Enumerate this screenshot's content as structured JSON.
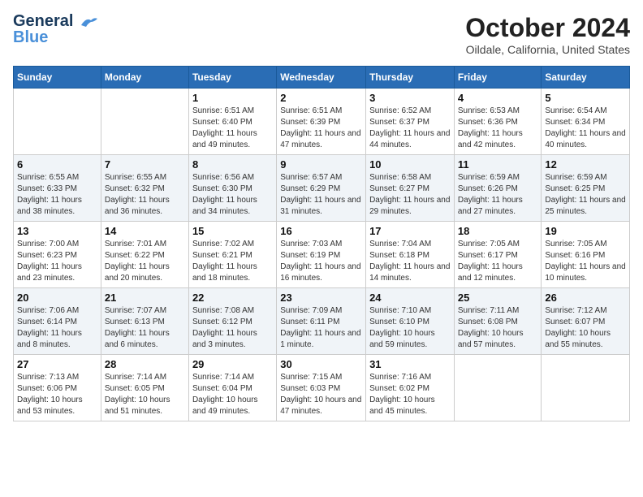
{
  "logo": {
    "line1": "General",
    "line2": "Blue"
  },
  "title": "October 2024",
  "location": "Oildale, California, United States",
  "days_header": [
    "Sunday",
    "Monday",
    "Tuesday",
    "Wednesday",
    "Thursday",
    "Friday",
    "Saturday"
  ],
  "weeks": [
    [
      {
        "day": "",
        "info": ""
      },
      {
        "day": "",
        "info": ""
      },
      {
        "day": "1",
        "info": "Sunrise: 6:51 AM\nSunset: 6:40 PM\nDaylight: 11 hours and 49 minutes."
      },
      {
        "day": "2",
        "info": "Sunrise: 6:51 AM\nSunset: 6:39 PM\nDaylight: 11 hours and 47 minutes."
      },
      {
        "day": "3",
        "info": "Sunrise: 6:52 AM\nSunset: 6:37 PM\nDaylight: 11 hours and 44 minutes."
      },
      {
        "day": "4",
        "info": "Sunrise: 6:53 AM\nSunset: 6:36 PM\nDaylight: 11 hours and 42 minutes."
      },
      {
        "day": "5",
        "info": "Sunrise: 6:54 AM\nSunset: 6:34 PM\nDaylight: 11 hours and 40 minutes."
      }
    ],
    [
      {
        "day": "6",
        "info": "Sunrise: 6:55 AM\nSunset: 6:33 PM\nDaylight: 11 hours and 38 minutes."
      },
      {
        "day": "7",
        "info": "Sunrise: 6:55 AM\nSunset: 6:32 PM\nDaylight: 11 hours and 36 minutes."
      },
      {
        "day": "8",
        "info": "Sunrise: 6:56 AM\nSunset: 6:30 PM\nDaylight: 11 hours and 34 minutes."
      },
      {
        "day": "9",
        "info": "Sunrise: 6:57 AM\nSunset: 6:29 PM\nDaylight: 11 hours and 31 minutes."
      },
      {
        "day": "10",
        "info": "Sunrise: 6:58 AM\nSunset: 6:27 PM\nDaylight: 11 hours and 29 minutes."
      },
      {
        "day": "11",
        "info": "Sunrise: 6:59 AM\nSunset: 6:26 PM\nDaylight: 11 hours and 27 minutes."
      },
      {
        "day": "12",
        "info": "Sunrise: 6:59 AM\nSunset: 6:25 PM\nDaylight: 11 hours and 25 minutes."
      }
    ],
    [
      {
        "day": "13",
        "info": "Sunrise: 7:00 AM\nSunset: 6:23 PM\nDaylight: 11 hours and 23 minutes."
      },
      {
        "day": "14",
        "info": "Sunrise: 7:01 AM\nSunset: 6:22 PM\nDaylight: 11 hours and 20 minutes."
      },
      {
        "day": "15",
        "info": "Sunrise: 7:02 AM\nSunset: 6:21 PM\nDaylight: 11 hours and 18 minutes."
      },
      {
        "day": "16",
        "info": "Sunrise: 7:03 AM\nSunset: 6:19 PM\nDaylight: 11 hours and 16 minutes."
      },
      {
        "day": "17",
        "info": "Sunrise: 7:04 AM\nSunset: 6:18 PM\nDaylight: 11 hours and 14 minutes."
      },
      {
        "day": "18",
        "info": "Sunrise: 7:05 AM\nSunset: 6:17 PM\nDaylight: 11 hours and 12 minutes."
      },
      {
        "day": "19",
        "info": "Sunrise: 7:05 AM\nSunset: 6:16 PM\nDaylight: 11 hours and 10 minutes."
      }
    ],
    [
      {
        "day": "20",
        "info": "Sunrise: 7:06 AM\nSunset: 6:14 PM\nDaylight: 11 hours and 8 minutes."
      },
      {
        "day": "21",
        "info": "Sunrise: 7:07 AM\nSunset: 6:13 PM\nDaylight: 11 hours and 6 minutes."
      },
      {
        "day": "22",
        "info": "Sunrise: 7:08 AM\nSunset: 6:12 PM\nDaylight: 11 hours and 3 minutes."
      },
      {
        "day": "23",
        "info": "Sunrise: 7:09 AM\nSunset: 6:11 PM\nDaylight: 11 hours and 1 minute."
      },
      {
        "day": "24",
        "info": "Sunrise: 7:10 AM\nSunset: 6:10 PM\nDaylight: 10 hours and 59 minutes."
      },
      {
        "day": "25",
        "info": "Sunrise: 7:11 AM\nSunset: 6:08 PM\nDaylight: 10 hours and 57 minutes."
      },
      {
        "day": "26",
        "info": "Sunrise: 7:12 AM\nSunset: 6:07 PM\nDaylight: 10 hours and 55 minutes."
      }
    ],
    [
      {
        "day": "27",
        "info": "Sunrise: 7:13 AM\nSunset: 6:06 PM\nDaylight: 10 hours and 53 minutes."
      },
      {
        "day": "28",
        "info": "Sunrise: 7:14 AM\nSunset: 6:05 PM\nDaylight: 10 hours and 51 minutes."
      },
      {
        "day": "29",
        "info": "Sunrise: 7:14 AM\nSunset: 6:04 PM\nDaylight: 10 hours and 49 minutes."
      },
      {
        "day": "30",
        "info": "Sunrise: 7:15 AM\nSunset: 6:03 PM\nDaylight: 10 hours and 47 minutes."
      },
      {
        "day": "31",
        "info": "Sunrise: 7:16 AM\nSunset: 6:02 PM\nDaylight: 10 hours and 45 minutes."
      },
      {
        "day": "",
        "info": ""
      },
      {
        "day": "",
        "info": ""
      }
    ]
  ]
}
